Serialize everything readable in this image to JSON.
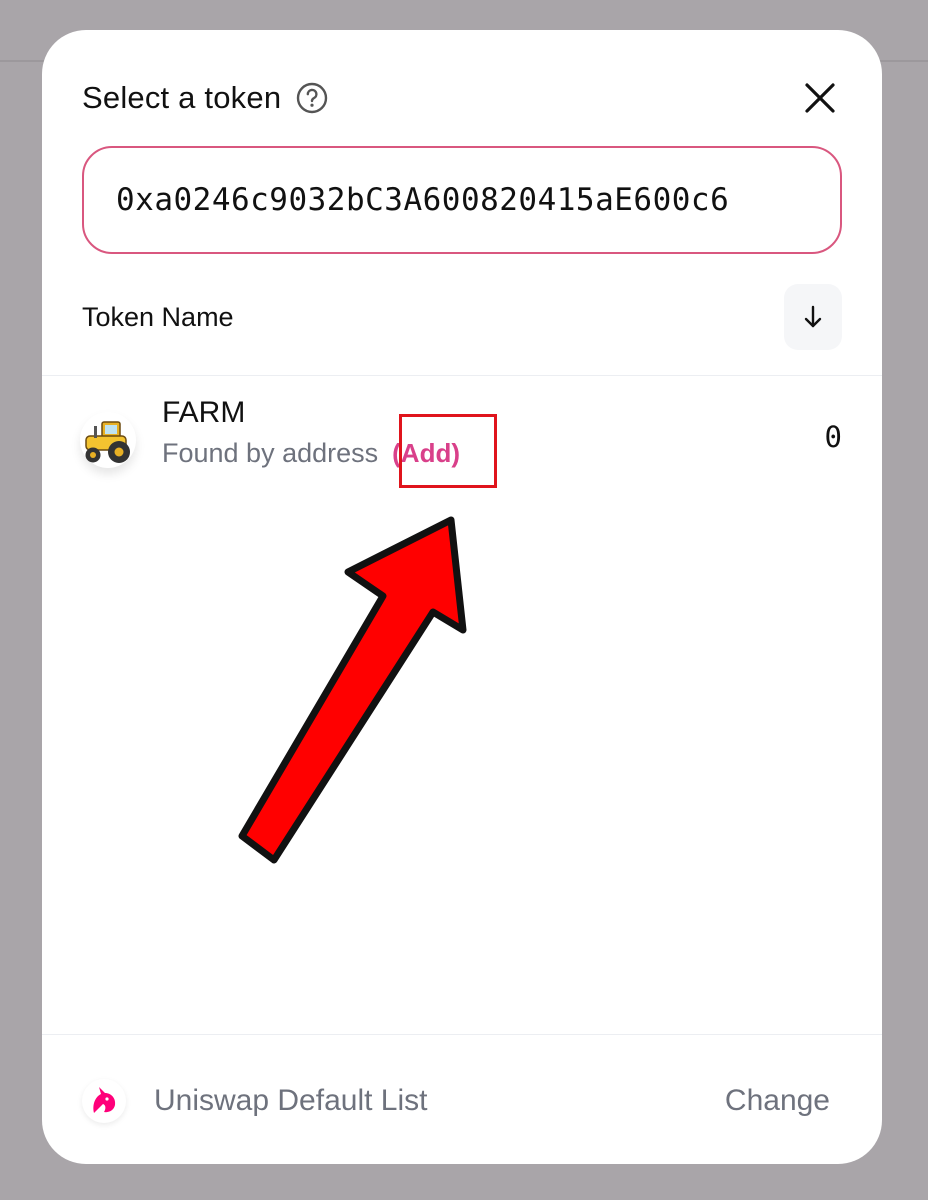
{
  "modal": {
    "title": "Select a token",
    "icons": {
      "help": "help-circle-icon",
      "close": "close-icon"
    }
  },
  "search": {
    "value": "0xa0246c9032bC3A600820415aE600c6",
    "border_color": "#d9577f"
  },
  "list_header": {
    "column_label": "Token Name",
    "sort_icon": "arrow-down-icon"
  },
  "tokens": [
    {
      "symbol": "FARM",
      "subtitle": "Found by address",
      "add_label": "(Add)",
      "balance": "0",
      "logo_icon": "tractor-icon"
    }
  ],
  "footer": {
    "list_name": "Uniswap Default List",
    "change_label": "Change",
    "logo_icon": "unicorn-icon"
  },
  "colors": {
    "accent_pink": "#d9408a",
    "annotation_red": "#ff0000"
  }
}
